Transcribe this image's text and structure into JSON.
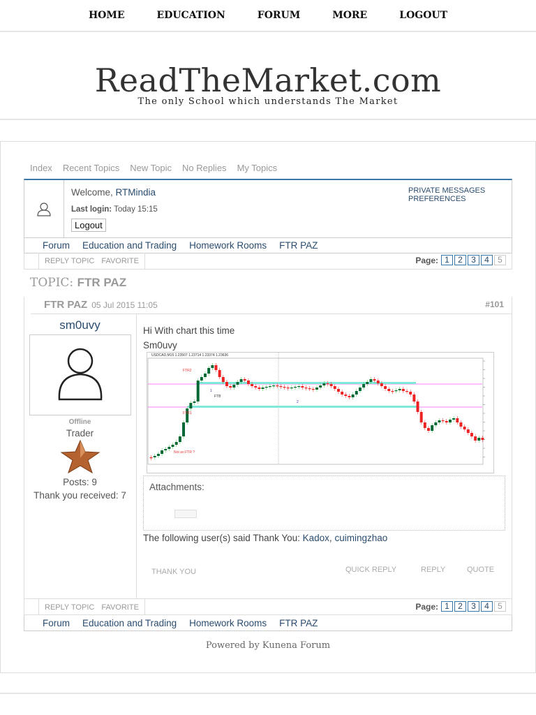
{
  "nav": [
    "HOME",
    "EDUCATION",
    "FORUM",
    "MORE",
    "LOGOUT"
  ],
  "site": {
    "title": "ReadTheMarket.com",
    "tagline": "The only School which understands The Market"
  },
  "tabs": [
    "Index",
    "Recent Topics",
    "New Topic",
    "No Replies",
    "My Topics"
  ],
  "profile": {
    "welcome": "Welcome, ",
    "user": "RTMindia",
    "last_login_label": "Last login:",
    "last_login": "Today 15:15",
    "logout": "Logout",
    "private_messages": "PRIVATE MESSAGES",
    "preferences": "PREFERENCES"
  },
  "breadcrumb": [
    "Forum",
    "Education and Trading",
    "Homework Rooms",
    "FTR PAZ"
  ],
  "actions": {
    "reply_topic": "REPLY TOPIC",
    "favorite": "FAVORITE",
    "page_label": "Page:",
    "pages": [
      "1",
      "2",
      "3",
      "4",
      "5"
    ]
  },
  "topic": {
    "prefix": "TOPIC:",
    "title": "FTR PAZ"
  },
  "post": {
    "subject": "FTR PAZ",
    "date": "05 Jul 2015 11:05",
    "number": "#101",
    "author": {
      "name": "sm0uvy",
      "status": "Offline",
      "rank": "Trader",
      "posts": "Posts: 9",
      "thanks": "Thank you received: 7"
    },
    "body": [
      "Hi With chart this time",
      "Sm0uvy"
    ],
    "chart": {
      "symbol": "USDCAD,M15  1.23507 1.23714 1.23374 1.23636",
      "labels": {
        "ftr1": "FTR1",
        "ftr2": "FTR2",
        "ftb": "FTB",
        "not_ftr": "Not an FTR ?",
        "one": "1",
        "two": "2"
      }
    },
    "attachments_label": "Attachments:",
    "thanks_text": "The following user(s) said Thank You: ",
    "thanks_users": [
      "Kadox",
      "cuimingzhao"
    ],
    "buttons": {
      "thank_you": "THANK YOU",
      "quick_reply": "QUICK REPLY",
      "reply": "REPLY",
      "quote": "QUOTE"
    }
  },
  "footer": {
    "powered": "Powered by Kunena Forum"
  }
}
